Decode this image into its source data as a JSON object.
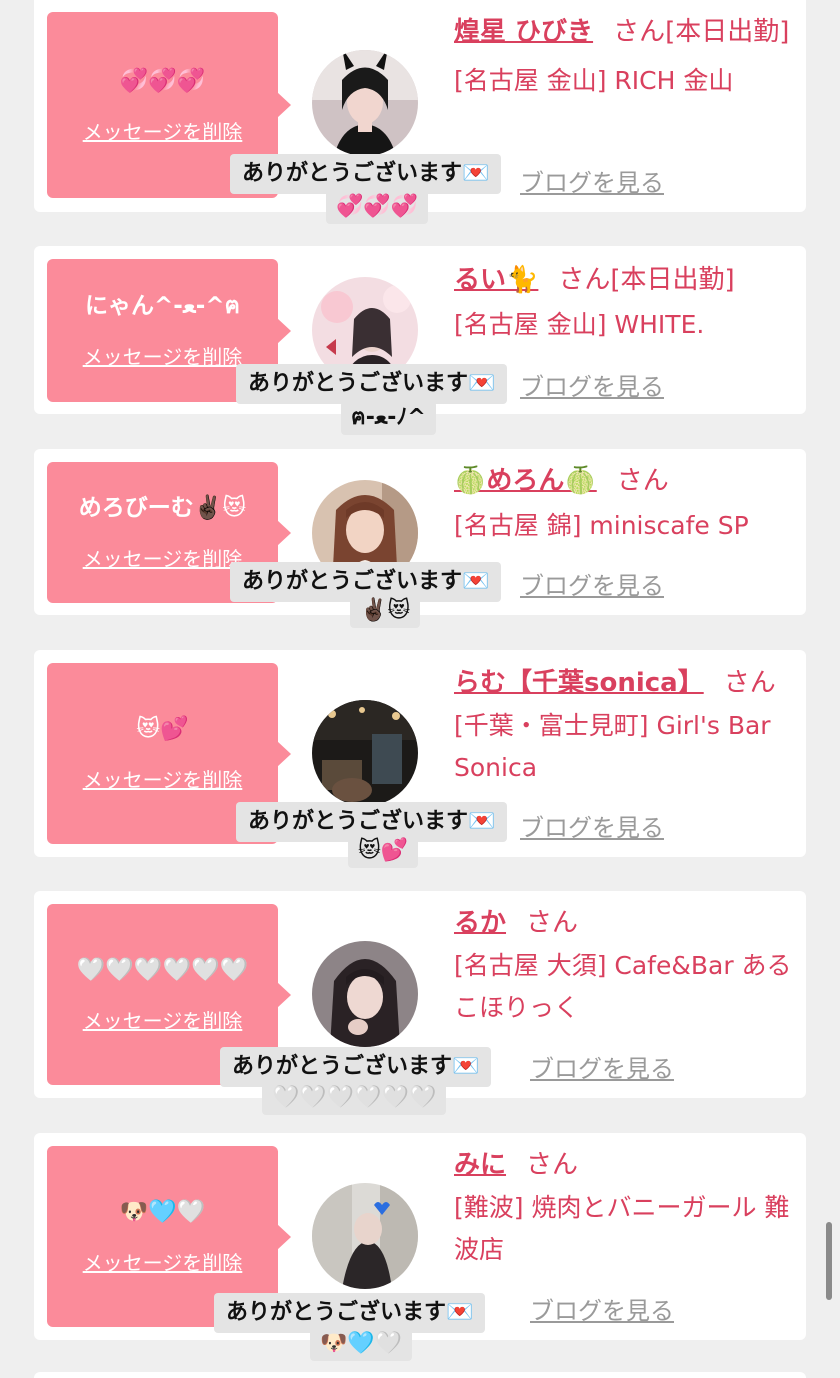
{
  "items": [
    {
      "message": "💞💞💞",
      "delete_label": "メッセージを削除",
      "name": "煌星 ひびき",
      "san": "さん[本日出勤]",
      "shop": "[名古屋 金山] RICH 金山",
      "blog_label": "ブログを見る",
      "reply": "ありがとうございます💌",
      "reply_extra": "💞💞💞"
    },
    {
      "message": "にゃん^-ﻌ-^ฅ",
      "delete_label": "メッセージを削除",
      "name": "るい🐈",
      "san": "さん[本日出勤]",
      "shop": "[名古屋 金山] WHITE.",
      "blog_label": "ブログを見る",
      "reply": "ありがとうございます💌",
      "reply_extra": "ฅ-ﻌ-ﾉ^"
    },
    {
      "message": "めろびーむ✌🏿😻",
      "delete_label": "メッセージを削除",
      "name": "🍈めろん🍈",
      "san": "さん",
      "shop": "[名古屋 錦] miniscafe SP",
      "blog_label": "ブログを見る",
      "reply": "ありがとうございます💌",
      "reply_extra": "✌🏿😻"
    },
    {
      "message": "😻💕",
      "delete_label": "メッセージを削除",
      "name": "らむ【千葉sonica】",
      "san": "さん",
      "shop": "[千葉・富士見町] Girl's Bar Sonica",
      "blog_label": "ブログを見る",
      "reply": "ありがとうございます💌",
      "reply_extra": "😻💕"
    },
    {
      "message": "🤍🤍🤍🤍🤍🤍",
      "delete_label": "メッセージを削除",
      "name": "るか",
      "san": "さん",
      "shop": "[名古屋 大須] Cafe&Bar あるこほりっく",
      "blog_label": "ブログを見る",
      "reply": "ありがとうございます💌",
      "reply_extra": "🤍🤍🤍🤍🤍🤍"
    },
    {
      "message": "🐶🩵🤍",
      "delete_label": "メッセージを削除",
      "name": "みに",
      "san": "さん",
      "shop": "[難波] 焼肉とバニーガール 難波店",
      "blog_label": "ブログを見る",
      "reply": "ありがとうございます💌",
      "reply_extra": "🐶🩵🤍"
    }
  ],
  "colors": {
    "page_bg": "#efefef",
    "card_bg": "#ffffff",
    "bubble_pink": "#fb8b9a",
    "accent_red": "#d9405e",
    "link_gray": "#9a9a9a"
  }
}
